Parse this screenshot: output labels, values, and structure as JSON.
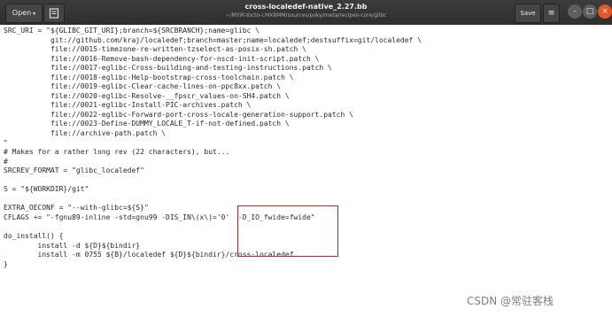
{
  "window": {
    "title": "cross-localedef-native_2.27.bb",
    "path": "~/MYiR-Yocto-i.MX8MM/sources/poky/meta/recipes-core/glibc",
    "open_label": "Open",
    "open_caret": "▾",
    "save_label": "Save",
    "menu_glyph": "≡",
    "minimize_glyph": "–",
    "maximize_glyph": "□",
    "close_glyph": "×",
    "accent_close": "#e95420"
  },
  "editor": {
    "lines": [
      "SRC_URI = \"${GLIBC_GIT_URI};branch=${SRCBRANCH};name=glibc \\",
      "           git://github.com/kraj/localedef;branch=master;name=localedef;destsuffix=git/localedef \\",
      "           file://0015-timezone-re-written-tzselect-as-posix-sh.patch \\",
      "           file://0016-Remove-bash-dependency-for-nscd-init-script.patch \\",
      "           file://0017-eglibc-Cross-building-and-testing-instructions.patch \\",
      "           file://0018-eglibc-Help-bootstrap-cross-toolchain.patch \\",
      "           file://0019-eglibc-Clear-cache-lines-on-ppc8xx.patch \\",
      "           file://0020-eglibc-Resolve-__fpscr_values-on-SH4.patch \\",
      "           file://0021-eglibc-Install-PIC-archives.patch \\",
      "           file://0022-eglibc-Forward-port-cross-locale-generation-support.patch \\",
      "           file://0023-Define-DUMMY_LOCALE_T-if-not-defined.patch \\",
      "           file://archive-path.patch \\",
      "\"",
      "# Makes for a rather long rev (22 characters), but...",
      "#",
      "SRCREV_FORMAT = \"glibc_localedef\"",
      "",
      "S = \"${WORKDIR}/git\"",
      "",
      "EXTRA_OECONF = \"--with-glibc=${S}\"",
      "CFLAGS += \"-fgnu89-inline -std=gnu99 -DIS_IN\\(x\\)='0'  -D_IO_fwide=fwide\"",
      "",
      "do_install() {",
      "        install -d ${D}${bindir}",
      "        install -m 0755 ${B}/localedef ${D}${bindir}/cross-localedef",
      "}"
    ]
  },
  "watermark": "CSDN @常驻客栈",
  "highlight_color": "#d21f1f"
}
